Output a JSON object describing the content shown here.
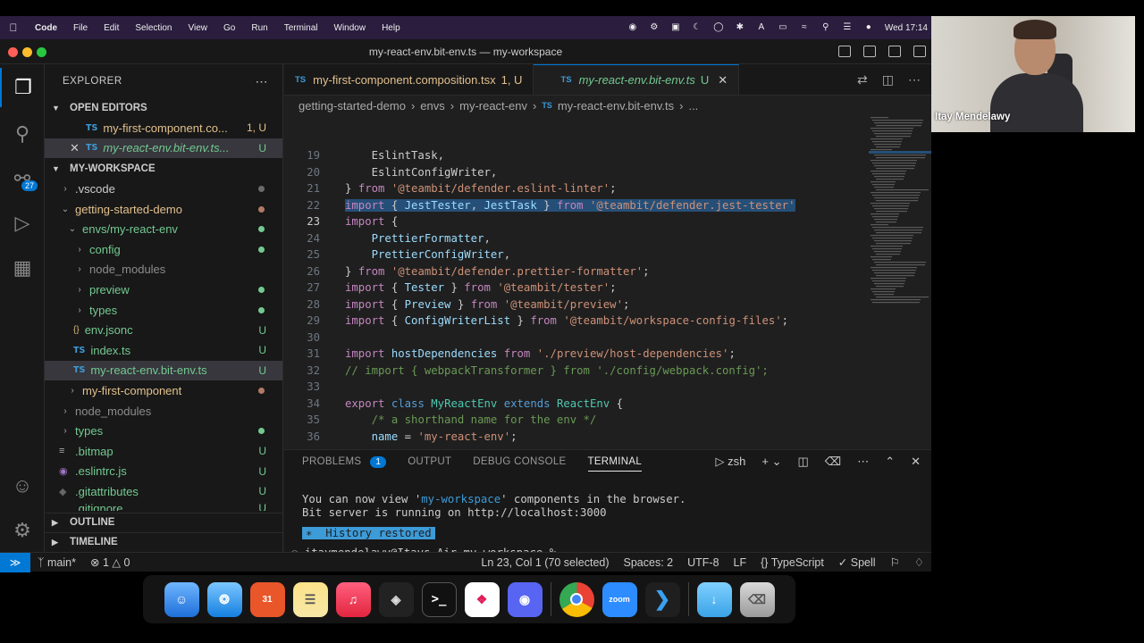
{
  "menubar": {
    "app": "Code",
    "items": [
      "File",
      "Edit",
      "Selection",
      "View",
      "Go",
      "Run",
      "Terminal",
      "Window",
      "Help"
    ],
    "clock": "Wed 17:14"
  },
  "window": {
    "title": "my-react-env.bit-env.ts — my-workspace"
  },
  "sidebar": {
    "title": "EXPLORER",
    "open_editors": "OPEN EDITORS",
    "open_files": [
      {
        "name": "my-first-component.co...",
        "status": "1, U"
      },
      {
        "name": "my-react-env.bit-env.ts...",
        "status": "U"
      }
    ],
    "workspace": "MY-WORKSPACE",
    "tree": [
      {
        "name": ".vscode"
      },
      {
        "name": "getting-started-demo"
      },
      {
        "name": "envs/my-react-env"
      },
      {
        "name": "config"
      },
      {
        "name": "node_modules"
      },
      {
        "name": "preview"
      },
      {
        "name": "types"
      },
      {
        "name": "env.jsonc",
        "status": "U",
        "icon": "{}"
      },
      {
        "name": "index.ts",
        "status": "U",
        "icon": "TS"
      },
      {
        "name": "my-react-env.bit-env.ts",
        "status": "U",
        "icon": "TS"
      },
      {
        "name": "my-first-component"
      },
      {
        "name": "node_modules"
      },
      {
        "name": "types"
      },
      {
        "name": ".bitmap",
        "status": "U"
      },
      {
        "name": ".eslintrc.js",
        "status": "U"
      },
      {
        "name": ".gitattributes",
        "status": "U"
      },
      {
        "name": ".gitignore",
        "status": "U"
      }
    ],
    "outline": "OUTLINE",
    "timeline": "TIMELINE"
  },
  "tabs": [
    {
      "label": "my-first-component.composition.tsx",
      "status": "1, U"
    },
    {
      "label": "my-react-env.bit-env.ts",
      "status": "U"
    }
  ],
  "breadcrumb": [
    "getting-started-demo",
    "envs",
    "my-react-env",
    "my-react-env.bit-env.ts",
    "..."
  ],
  "code": {
    "lines": [
      {
        "n": "19",
        "tokens": [
          [
            "pl",
            "    EslintTask,"
          ]
        ]
      },
      {
        "n": "20",
        "tokens": [
          [
            "pl",
            "    EslintConfigWriter,"
          ]
        ]
      },
      {
        "n": "21",
        "tokens": [
          [
            "pl",
            "} "
          ],
          [
            "kw",
            "from"
          ],
          [
            "pl",
            " "
          ],
          [
            "str",
            "'@teambit/defender.eslint-linter'"
          ],
          [
            "pl",
            ";"
          ]
        ]
      },
      {
        "n": "22",
        "tokens": [
          [
            "kw",
            "import"
          ],
          [
            "pl",
            " { "
          ],
          [
            "id",
            "JestTester"
          ],
          [
            "pl",
            ", "
          ],
          [
            "id",
            "JestTask"
          ],
          [
            "pl",
            " } "
          ],
          [
            "kw",
            "from"
          ],
          [
            "pl",
            " "
          ],
          [
            "str",
            "'@teambit/defender.jest-tester'"
          ]
        ],
        "highlight": true
      },
      {
        "n": "23",
        "tokens": [
          [
            "kw",
            "import"
          ],
          [
            "pl",
            " {"
          ]
        ],
        "current": true
      },
      {
        "n": "24",
        "tokens": [
          [
            "pl",
            "    "
          ],
          [
            "id",
            "PrettierFormatter"
          ],
          [
            "pl",
            ","
          ]
        ]
      },
      {
        "n": "25",
        "tokens": [
          [
            "pl",
            "    "
          ],
          [
            "id",
            "PrettierConfigWriter"
          ],
          [
            "pl",
            ","
          ]
        ]
      },
      {
        "n": "26",
        "tokens": [
          [
            "pl",
            "} "
          ],
          [
            "kw",
            "from"
          ],
          [
            "pl",
            " "
          ],
          [
            "str",
            "'@teambit/defender.prettier-formatter'"
          ],
          [
            "pl",
            ";"
          ]
        ]
      },
      {
        "n": "27",
        "tokens": [
          [
            "kw",
            "import"
          ],
          [
            "pl",
            " { "
          ],
          [
            "id",
            "Tester"
          ],
          [
            "pl",
            " } "
          ],
          [
            "kw",
            "from"
          ],
          [
            "pl",
            " "
          ],
          [
            "str",
            "'@teambit/tester'"
          ],
          [
            "pl",
            ";"
          ]
        ]
      },
      {
        "n": "28",
        "tokens": [
          [
            "kw",
            "import"
          ],
          [
            "pl",
            " { "
          ],
          [
            "id",
            "Preview"
          ],
          [
            "pl",
            " } "
          ],
          [
            "kw",
            "from"
          ],
          [
            "pl",
            " "
          ],
          [
            "str",
            "'@teambit/preview'"
          ],
          [
            "pl",
            ";"
          ]
        ]
      },
      {
        "n": "29",
        "tokens": [
          [
            "kw",
            "import"
          ],
          [
            "pl",
            " { "
          ],
          [
            "id",
            "ConfigWriterList"
          ],
          [
            "pl",
            " } "
          ],
          [
            "kw",
            "from"
          ],
          [
            "pl",
            " "
          ],
          [
            "str",
            "'@teambit/workspace-config-files'"
          ],
          [
            "pl",
            ";"
          ]
        ]
      },
      {
        "n": "30",
        "tokens": []
      },
      {
        "n": "31",
        "tokens": [
          [
            "kw",
            "import"
          ],
          [
            "pl",
            " "
          ],
          [
            "id",
            "hostDependencies"
          ],
          [
            "pl",
            " "
          ],
          [
            "kw",
            "from"
          ],
          [
            "pl",
            " "
          ],
          [
            "str",
            "'./preview/host-dependencies'"
          ],
          [
            "pl",
            ";"
          ]
        ]
      },
      {
        "n": "32",
        "tokens": [
          [
            "cm",
            "// import { webpackTransformer } from './config/webpack.config';"
          ]
        ]
      },
      {
        "n": "33",
        "tokens": []
      },
      {
        "n": "34",
        "tokens": [
          [
            "kw",
            "export"
          ],
          [
            "pl",
            " "
          ],
          [
            "blue",
            "class"
          ],
          [
            "pl",
            " "
          ],
          [
            "cls",
            "MyReactEnv"
          ],
          [
            "pl",
            " "
          ],
          [
            "blue",
            "extends"
          ],
          [
            "pl",
            " "
          ],
          [
            "cls",
            "ReactEnv"
          ],
          [
            "pl",
            " {"
          ]
        ]
      },
      {
        "n": "35",
        "tokens": [
          [
            "pl",
            "    "
          ],
          [
            "cm",
            "/* a shorthand name for the env */"
          ]
        ]
      },
      {
        "n": "36",
        "tokens": [
          [
            "pl",
            "    "
          ],
          [
            "id",
            "name"
          ],
          [
            "pl",
            " = "
          ],
          [
            "str",
            "'my-react-env'"
          ],
          [
            "pl",
            ";"
          ]
        ]
      }
    ]
  },
  "panel": {
    "tabs": [
      "PROBLEMS",
      "OUTPUT",
      "DEBUG CONSOLE",
      "TERMINAL"
    ],
    "problems_count": "1",
    "shell": "zsh",
    "terminal": {
      "line1_pre": "You can now view '",
      "line1_hl": "my-workspace",
      "line1_post": "' components in the browser.",
      "line2": "Bit server is running on http://localhost:3000",
      "history": "History restored",
      "prompt": "itaymendelawy@Itays-Air my-workspace %"
    }
  },
  "status": {
    "branch": "main*",
    "errors": "1",
    "warnings": "0",
    "cursor": "Ln 23, Col 1 (70 selected)",
    "spaces": "Spaces: 2",
    "encoding": "UTF-8",
    "eol": "LF",
    "language": "TypeScript",
    "spell": "Spell"
  },
  "dock": {
    "calendar_day": "31",
    "zoom": "zoom"
  },
  "webcam": {
    "name": "Itay Mendelawy"
  }
}
